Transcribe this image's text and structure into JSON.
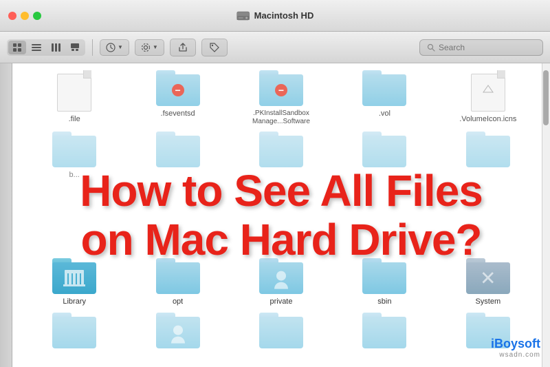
{
  "titlebar": {
    "title": "Macintosh HD"
  },
  "toolbar": {
    "search_placeholder": "Search",
    "view_modes": [
      "icon",
      "list",
      "column",
      "cover"
    ],
    "arrange_label": "Arrange",
    "action_label": "Action",
    "share_label": "Share",
    "tag_label": "Tag"
  },
  "overlay": {
    "line1": "How to See All Files",
    "line2": "on Mac Hard Drive?"
  },
  "files_row1": [
    {
      "name": ".file",
      "type": "doc"
    },
    {
      "name": ".fseventsd",
      "type": "folder-badge"
    },
    {
      "name": ".PKInstallSandbox Manage...Software",
      "type": "folder-badge"
    },
    {
      "name": ".vol",
      "type": "folder"
    },
    {
      "name": ".VolumeIcon.icns",
      "type": "doc"
    }
  ],
  "files_row2": [
    {
      "name": "b...",
      "type": "folder"
    },
    {
      "name": "",
      "type": "folder"
    },
    {
      "name": "",
      "type": "folder"
    },
    {
      "name": "",
      "type": "folder"
    },
    {
      "name": "",
      "type": "folder"
    }
  ],
  "files_row3": [
    {
      "name": "Library",
      "type": "folder-library"
    },
    {
      "name": "opt",
      "type": "folder"
    },
    {
      "name": "private",
      "type": "folder-person"
    },
    {
      "name": "sbin",
      "type": "folder"
    },
    {
      "name": "System",
      "type": "folder-system"
    }
  ],
  "files_row4": [
    {
      "name": "",
      "type": "folder"
    },
    {
      "name": "",
      "type": "folder-person"
    },
    {
      "name": "",
      "type": "folder"
    },
    {
      "name": "",
      "type": "folder"
    },
    {
      "name": "",
      "type": "folder"
    }
  ],
  "branding": {
    "name": "iBoysoft",
    "sub": "wsadn.com",
    "color": "#1a73e8"
  }
}
